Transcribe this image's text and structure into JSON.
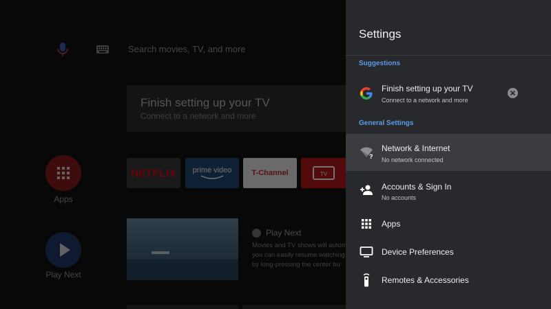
{
  "home": {
    "search_placeholder": "Search movies, TV, and more",
    "setup_banner": {
      "title": "Finish setting up your TV",
      "subtitle": "Connect to a network and more"
    },
    "side_apps": [
      {
        "label": "Apps",
        "icon": "apps-grid-icon"
      },
      {
        "label": "Play Next",
        "icon": "play-icon"
      }
    ],
    "channels": [
      {
        "name": "NETFLIX"
      },
      {
        "name_line1": "prime video"
      },
      {
        "name": "T-Channel"
      },
      {
        "name": "TV"
      }
    ],
    "play_next": {
      "title": "Play Next",
      "description_lines": [
        "Movies and TV shows will autom",
        "you can easily resume watching",
        "by long-pressing the center bu"
      ]
    }
  },
  "settings": {
    "title": "Settings",
    "suggestions_header": "Suggestions",
    "suggestion": {
      "title": "Finish setting up your TV",
      "subtitle": "Connect to a network and more",
      "icon": "google-g-icon"
    },
    "general_header": "General Settings",
    "items": [
      {
        "label": "Network & Internet",
        "sub": "No network connected",
        "icon": "wifi-question-icon",
        "selected": true
      },
      {
        "label": "Accounts & Sign In",
        "sub": "No accounts",
        "icon": "add-person-icon"
      },
      {
        "label": "Apps",
        "icon": "apps-grid-icon"
      },
      {
        "label": "Device Preferences",
        "icon": "tv-monitor-icon"
      },
      {
        "label": "Remotes & Accessories",
        "icon": "remote-icon"
      }
    ]
  },
  "colors": {
    "panel_bg": "#27292c",
    "section_header": "#5b9ce8",
    "selected_row": "#3a3c40",
    "netflix_red": "#e50914"
  }
}
